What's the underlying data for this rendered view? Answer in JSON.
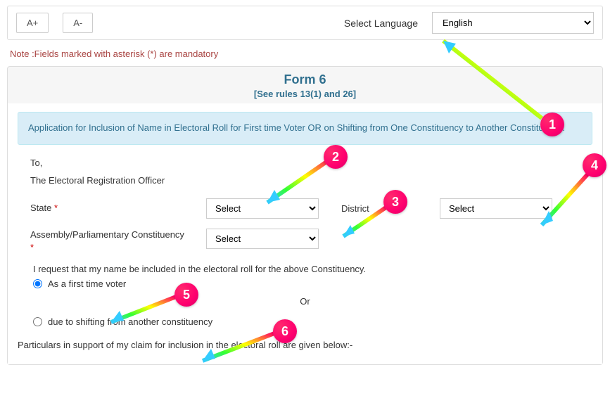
{
  "topbar": {
    "a_plus": "A+",
    "a_minus": "A-",
    "lang_label": "Select Language",
    "lang_value": "English"
  },
  "note": "Note :Fields marked with asterisk (*) are mandatory",
  "form": {
    "title": "Form 6",
    "subtitle": "[See rules 13(1) and 26]",
    "description": "Application for Inclusion of Name in Electoral Roll for First time Voter OR on Shifting from One Constituency to Another Constituency.",
    "to": "To,",
    "officer": "The Electoral Registration Officer",
    "state_label": "State",
    "state_value": "Select",
    "district_label": "District",
    "district_value": "Select",
    "constituency_label": "Assembly/Parliamentary Constituency",
    "constituency_value": "Select",
    "request_text": "I request that my name be included in the electoral roll for the above Constituency.",
    "radio1": "As a first time voter",
    "or": "Or",
    "radio2": "due to shifting from another constituency",
    "particulars": "Particulars in support of my claim for inclusion in the electoral roll are given below:-",
    "asterisk": "*"
  },
  "annotations": {
    "b1": "1",
    "b2": "2",
    "b3": "3",
    "b4": "4",
    "b5": "5",
    "b6": "6"
  }
}
